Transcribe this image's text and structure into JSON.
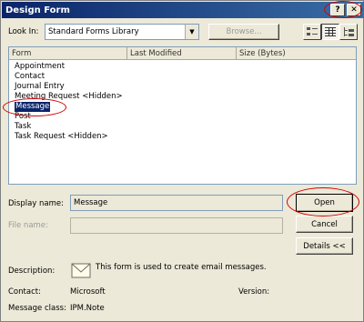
{
  "window": {
    "title": "Design Form",
    "help_glyph": "?",
    "close_glyph": "✕"
  },
  "look_in": {
    "label": "Look In:",
    "value": "Standard Forms Library",
    "browse_label": "Browse..."
  },
  "view_buttons": [
    "large-icons-view",
    "details-view",
    "tree-view"
  ],
  "columns": [
    "Form",
    "Last Modified",
    "Size (Bytes)"
  ],
  "forms": [
    "Appointment",
    "Contact",
    "Journal Entry",
    "Meeting Request <Hidden>",
    "Message",
    "Post",
    "Task",
    "Task Request <Hidden>"
  ],
  "selected_form": "Message",
  "fields": {
    "display_name_label": "Display name:",
    "display_name_value": "Message",
    "file_name_label": "File name:",
    "file_name_value": ""
  },
  "buttons": {
    "open": "Open",
    "cancel": "Cancel",
    "details": "Details <<"
  },
  "details": {
    "description_label": "Description:",
    "description_value": "This form is used to create email messages.",
    "contact_label": "Contact:",
    "contact_value": "Microsoft",
    "version_label": "Version:",
    "version_value": "",
    "message_class_label": "Message class:",
    "message_class_value": "IPM.Note"
  },
  "colors": {
    "title_bar": "#0a246a",
    "selection": "#0a246a",
    "annotation": "#d40000",
    "dialog_bg": "#ece9d8"
  }
}
